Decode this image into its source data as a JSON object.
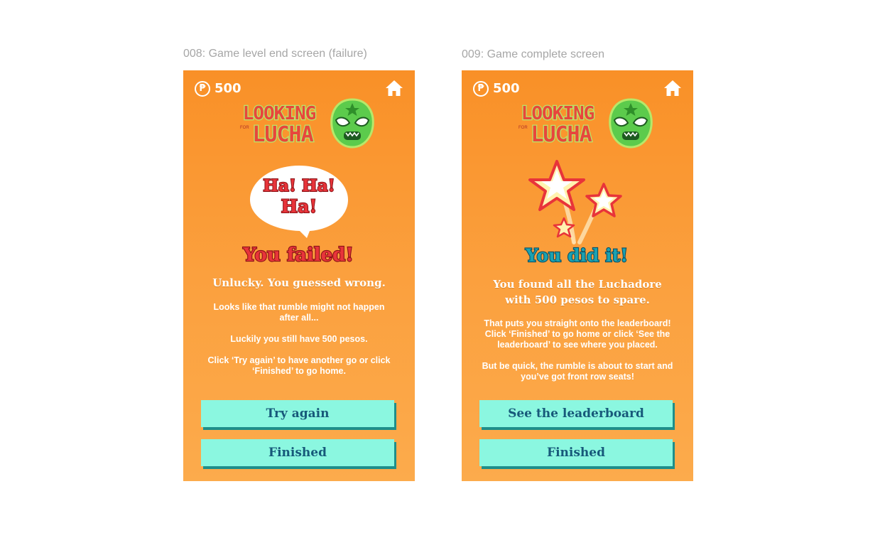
{
  "captions": {
    "left": "008: Game level end screen (failure)",
    "right": "009: Game complete screen"
  },
  "colors": {
    "background_top": "#f99027",
    "background_bottom": "#fcab4c",
    "button_fill": "#8bf7e0",
    "button_text": "#17597a",
    "fail_red": "#e8343a",
    "success_teal": "#1aa2b2"
  },
  "failure_screen": {
    "currency_symbol": "₱",
    "pesos": "500",
    "logo": {
      "line1": "LOOKING",
      "line2": "LUCHA",
      "small": "FOR"
    },
    "speech_bubble": {
      "line1": "Ha! Ha!",
      "line2": "Ha!"
    },
    "headline": "You failed!",
    "subtitle": "Unlucky. You guessed wrong.",
    "paragraph1": "Looks like that rumble might not happen\nafter all...",
    "paragraph2": "Luckily you still have 500 pesos.",
    "paragraph3": "Click ‘Try again’ to have another go or click\n‘Finished’ to go home.",
    "primary_button": "Try again",
    "secondary_button": "Finished",
    "home_icon": "home-icon"
  },
  "success_screen": {
    "currency_symbol": "₱",
    "pesos": "500",
    "logo": {
      "line1": "LOOKING",
      "line2": "LUCHA",
      "small": "FOR"
    },
    "headline": "You did it!",
    "subtitle_line1": "You found all the Luchadore",
    "subtitle_line2": "with 500 pesos to spare.",
    "paragraph1": "That puts you straight onto the leaderboard!\nClick ‘Finished’ to go home or click ‘See the\nleaderboard’ to see where you placed.",
    "paragraph2": "But be quick, the rumble is about to start and\nyou’ve got front row seats!",
    "primary_button": "See the leaderboard",
    "secondary_button": "Finished",
    "home_icon": "home-icon"
  }
}
